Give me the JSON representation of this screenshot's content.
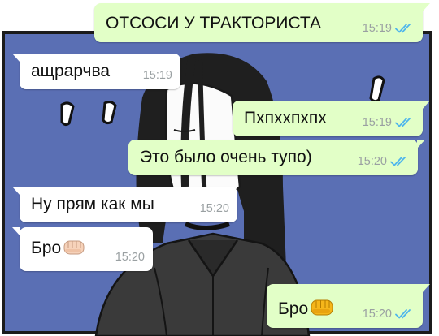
{
  "chat": {
    "messages": [
      {
        "dir": "out",
        "text": "ОТСОСИ У ТРАКТОРИСТА",
        "time": "15:19",
        "read": true
      },
      {
        "dir": "in",
        "text": "ащрарчва",
        "time": "15:19"
      },
      {
        "dir": "out",
        "text": "Пхпххпхпх",
        "time": "15:19",
        "read": true
      },
      {
        "dir": "out",
        "text": "Это было очень тупо)",
        "time": "15:20",
        "read": true
      },
      {
        "dir": "in",
        "text": "Ну прям как мы",
        "time": "15:20"
      },
      {
        "dir": "in",
        "text": "Бро",
        "emoji": "fist-bump-emoji",
        "time": "15:20"
      },
      {
        "dir": "out",
        "text": "Бро",
        "emoji": "fist-bump-emoji",
        "time": "15:20",
        "read": true
      }
    ]
  },
  "colors": {
    "outgoing_bubble": "#e2ffc7",
    "incoming_bubble": "#ffffff",
    "read_ticks": "#4fb6ec",
    "wallpaper_blue": "#5a6fb4"
  }
}
